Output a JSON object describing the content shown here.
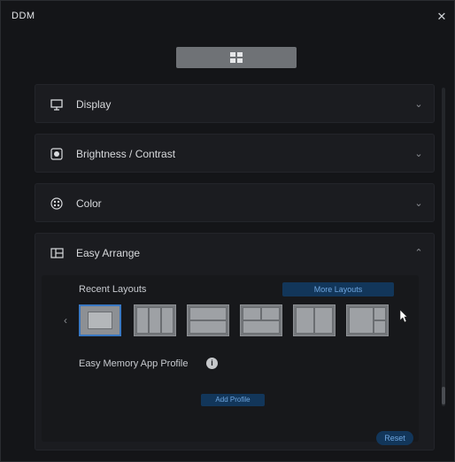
{
  "window": {
    "title": "DDM",
    "close_glyph": "✕"
  },
  "top_tab": {
    "icon": "grid-icon"
  },
  "sections": [
    {
      "label": "Display",
      "icon": "monitor-icon",
      "chevron": "⌄"
    },
    {
      "label": "Brightness / Contrast",
      "icon": "brightness-icon",
      "chevron": "⌄"
    },
    {
      "label": "Color",
      "icon": "color-palette-icon",
      "chevron": "⌄"
    },
    {
      "label": "Easy Arrange",
      "icon": "easy-arrange-icon",
      "chevron": "⌃"
    }
  ],
  "easy_arrange": {
    "recent_label": "Recent Layouts",
    "more_link": "More Layouts",
    "prev_glyph": "‹",
    "easy_memory_label": "Easy Memory App Profile",
    "info_glyph": "i",
    "add_profile_label": "Add Profile",
    "reset_label": "Reset"
  },
  "colors": {
    "accent": "#3a78c2",
    "link_text": "#6ea6e0",
    "button_bg": "#12365a"
  }
}
